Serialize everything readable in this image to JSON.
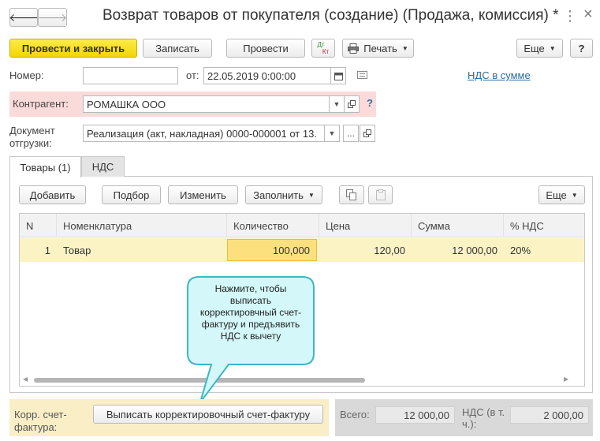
{
  "window": {
    "title": "Возврат товаров от покупателя (создание) (Продажа, комиссия) *",
    "back_glyph": "🡐",
    "forward_glyph": "🡒",
    "more_glyph": "⋮",
    "close_glyph": "×"
  },
  "toolbar": {
    "post_close": "Провести и закрыть",
    "save": "Записать",
    "post": "Провести",
    "dtkt_top": "Дт",
    "dtkt_bottom": "Кт",
    "print": "Печать",
    "more": "Еще",
    "help": "?"
  },
  "header": {
    "number_label": "Номер:",
    "number_value": "",
    "date_label": "от:",
    "date_value": "22.05.2019  0:00:00",
    "vat_link": "НДС в сумме",
    "counterparty_label": "Контрагент:",
    "counterparty_value": "РОМАШКА ООО",
    "counterparty_help": "?",
    "shipment_label_1": "Документ",
    "shipment_label_2": "отгрузки:",
    "shipment_value": "Реализация (акт, накладная) 0000-000001 от 13.",
    "ellipsis": "..."
  },
  "tabs": [
    {
      "label": "Товары (1)",
      "active": true
    },
    {
      "label": "НДС",
      "active": false
    }
  ],
  "goods_toolbar": {
    "add": "Добавить",
    "pick": "Подбор",
    "edit": "Изменить",
    "fill": "Заполнить",
    "more": "Еще"
  },
  "table": {
    "columns": [
      "N",
      "Номенклатура",
      "Количество",
      "Цена",
      "Сумма",
      "% НДС"
    ],
    "rows": [
      {
        "n": "1",
        "item": "Товар",
        "qty": "100,000",
        "price": "120,00",
        "sum": "12 000,00",
        "vat": "20%"
      }
    ]
  },
  "tooltip": {
    "text": "Нажмите, чтобы выписать корректировчный счет-фактуру и предъявить НДС к вычету"
  },
  "footer": {
    "invoice_label_1": "Корр. счет-",
    "invoice_label_2": "фактура:",
    "invoice_button": "Выписать корректировочный счет-фактуру",
    "total_label": "Всего:",
    "total_value": "12 000,00",
    "vat_label_1": "НДС (в т.",
    "vat_label_2": "ч.):",
    "vat_value": "2 000,00"
  },
  "colors": {
    "primary_button": "#f2d504",
    "counterparty_highlight": "#fbdada",
    "selected_row": "#fbf3c4",
    "active_cell": "#fce07e",
    "tooltip_fill": "#d4f8f9",
    "tooltip_border": "#3bb7c4",
    "footer_highlight": "#faeec6",
    "link": "#2b6ca3"
  }
}
